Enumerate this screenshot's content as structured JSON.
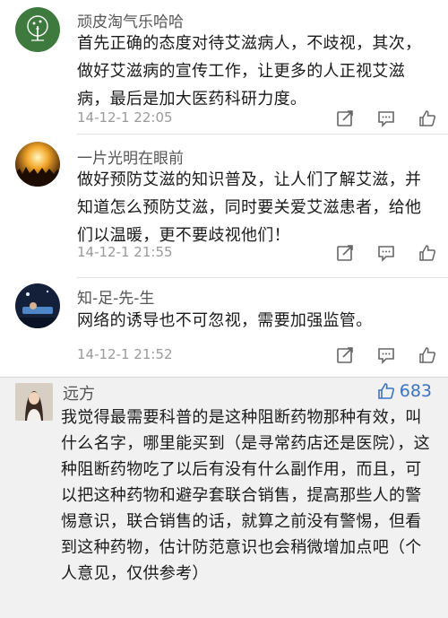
{
  "comments": [
    {
      "username": "顽皮淘气乐哈哈",
      "text": "首先正确的态度对待艾滋病人，不歧视，其次，做好艾滋病的宣传工作，让更多的人正视艾滋病，最后是加大医药科研力度。",
      "time": "14-12-1 22:05",
      "avatar_icon": "tree-avatar-icon"
    },
    {
      "username": "一片光明在眼前",
      "text": "做好预防艾滋的知识普及，让人们了解艾滋，并知道怎么预防艾滋，同时要关爱艾滋患者，给他们以温暖，更不要歧视他们！",
      "time": "14-12-1 21:55",
      "avatar_icon": "crowd-light-avatar-icon"
    },
    {
      "username": "知-足-先-生",
      "text": "网络的诱导也不可忽视，需要加强监管。",
      "time": "14-12-1 21:52",
      "avatar_icon": "night-scene-avatar-icon"
    }
  ],
  "featured": {
    "username": "远方",
    "likes": "683",
    "text": "我觉得最需要科普的是这种阻断药物那种有效，叫什么名字，哪里能买到（是寻常药店还是医院），这种阻断药物吃了以后有没有什么副作用，而且，可以把这种药物和避孕套联合销售，提高那些人的警惕意识，联合销售的话，就算之前没有警惕，但看到这种药物，估计防范意识也会稍微增加点吧（个人意见，仅供参考）",
    "avatar_icon": "portrait-avatar-icon",
    "accent_color": "#3b73c5"
  },
  "action_icons": [
    "share-icon",
    "comment-icon",
    "like-icon"
  ]
}
